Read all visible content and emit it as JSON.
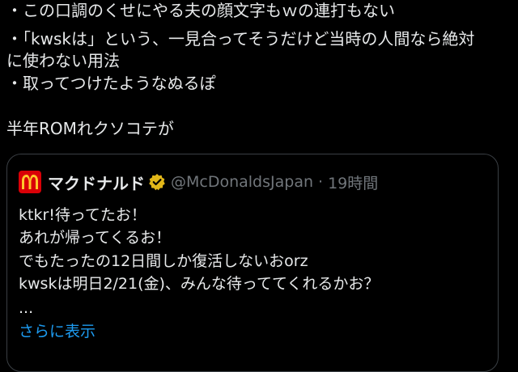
{
  "post": {
    "lines": [
      "・この口調のくせにやる夫の顔文字もｗの連打もない",
      "・「kwskは」という、一見合ってそうだけど当時の人間なら絶対",
      "に使わない用法",
      "・取ってつけたようなぬるぽ",
      "半年ROMれクソコテが"
    ]
  },
  "quote": {
    "display_name": "マクドナルド",
    "verified": true,
    "handle": "@McDonaldsJapan",
    "separator": "·",
    "time": "19時間",
    "lines": [
      "ktkr!待ってたお！",
      "あれが帰ってくるお！",
      "でもたったの12日間しか復活しないおorz",
      "kwskは明日2/21(金)、みんな待っててくれるかお？",
      "..."
    ],
    "show_more": "さらに表示"
  },
  "colors": {
    "background": "#000000",
    "text": "#e7e9ea",
    "muted": "#71767b",
    "link": "#1d9bf0",
    "mcd_red": "#d90007",
    "mcd_yellow": "#ffc72c",
    "verified_gold": "#e2b719"
  },
  "icons": {
    "avatar": "mcdonalds-logo-icon",
    "verified": "verified-badge-icon"
  }
}
